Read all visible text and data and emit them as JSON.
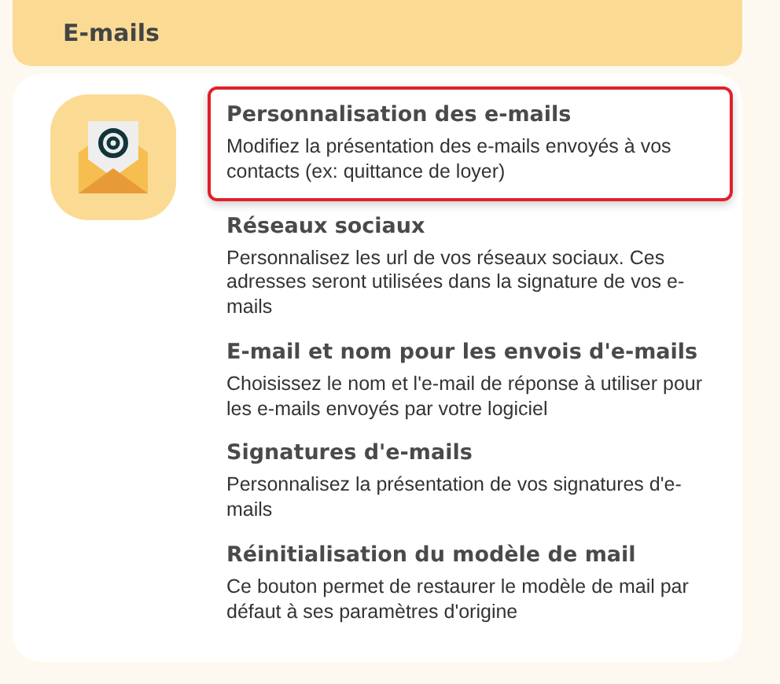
{
  "section": {
    "title": "E-mails"
  },
  "items": [
    {
      "title": "Personnalisation des e-mails",
      "description": "Modifiez la présentation des e-mails envoyés à vos contacts (ex: quittance de loyer)",
      "selected": true
    },
    {
      "title": "Réseaux sociaux",
      "description": "Personnalisez les url de vos réseaux sociaux. Ces adresses seront utilisées dans la signature de vos e-mails",
      "selected": false
    },
    {
      "title": "E-mail et nom pour les envois d'e-mails",
      "description": "Choisissez le nom et l'e-mail de réponse à utiliser pour les e-mails envoyés par votre logiciel",
      "selected": false
    },
    {
      "title": "Signatures d'e-mails",
      "description": "Personnalisez la présentation de vos signatures d'e-mails",
      "selected": false
    },
    {
      "title": "Réinitialisation du modèle de mail",
      "description": "Ce bouton permet de restaurer le modèle de mail par défaut à ses paramètres d'origine",
      "selected": false
    }
  ]
}
